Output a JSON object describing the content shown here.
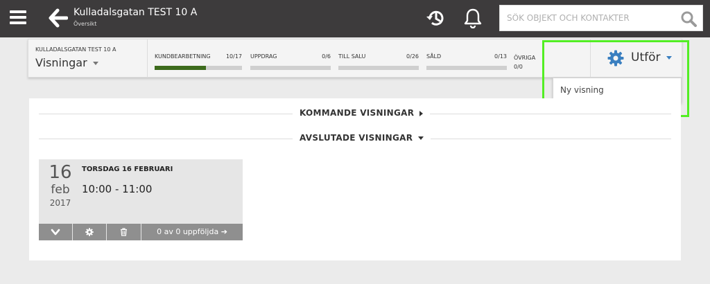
{
  "header": {
    "title": "Kulladalsgatan TEST 10 A",
    "subtitle": "Översikt",
    "search_placeholder": "SÖK OBJEKT OCH KONTAKTER"
  },
  "subheader": {
    "object_name": "KULLADALSGATAN TEST 10 A",
    "view_select": "Visningar",
    "progress": [
      {
        "label": "KUNDBEARBETNING",
        "count": "10/17",
        "fraction": 0.588
      },
      {
        "label": "UPPDRAG",
        "count": "0/6",
        "fraction": 0
      },
      {
        "label": "TILL SALU",
        "count": "0/26",
        "fraction": 0
      },
      {
        "label": "SÅLD",
        "count": "0/13",
        "fraction": 0
      }
    ],
    "other_label": "ÖVRIGA",
    "other_count": "0/0",
    "action_label": "Utför"
  },
  "action_menu": {
    "items": [
      "Ny visning"
    ]
  },
  "sections": {
    "upcoming": "KOMMANDE VISNINGAR",
    "finished": "AVSLUTADE VISNINGAR"
  },
  "showing": {
    "day": "16",
    "month": "feb",
    "year": "2017",
    "title": "TORSDAG 16 FEBRUARI",
    "time": "10:00 - 11:00",
    "followup": "0 av 0 uppföljda"
  },
  "colors": {
    "topbar": "#3d3b3c",
    "progress_fill": "#3d6b1d",
    "accent": "#3a7fc0",
    "highlight": "#53ee24"
  }
}
